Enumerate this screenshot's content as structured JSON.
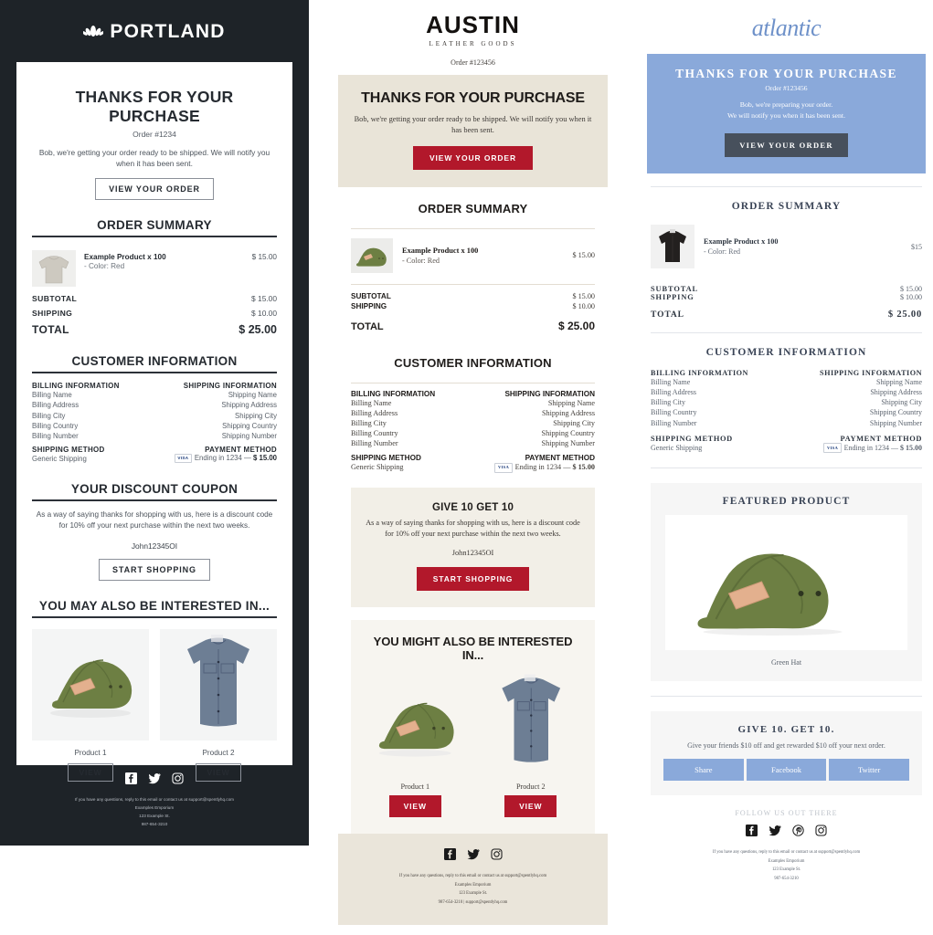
{
  "portland": {
    "brand": "PORTLAND",
    "logo_icon": "lotus-icon",
    "heading": "THANKS FOR YOUR PURCHASE",
    "order_number": "Order #1234",
    "intro": "Bob, we're getting your order ready to be shipped. We will notify you when it has been sent.",
    "cta": "VIEW YOUR ORDER",
    "order_summary_title": "ORDER SUMMARY",
    "item": {
      "name": "Example Product x 100",
      "option": "- Color: Red",
      "price": "$ 15.00",
      "image": "grey-sweater"
    },
    "totals": [
      {
        "label": "SUBTOTAL",
        "value": "$ 15.00"
      },
      {
        "label": "SHIPPING",
        "value": "$ 10.00"
      },
      {
        "label": "TOTAL",
        "value": "$ 25.00"
      }
    ],
    "customer_info_title": "CUSTOMER INFORMATION",
    "billing_title": "BILLING INFORMATION",
    "billing_lines": [
      "Billing Name",
      "Billing Address",
      "Billing City",
      "Billing Country",
      "Billing Number"
    ],
    "shipping_title": "SHIPPING INFORMATION",
    "shipping_lines": [
      "Shipping Name",
      "Shipping Address",
      "Shipping City",
      "Shipping Country",
      "Shipping Number"
    ],
    "shipping_method_title": "SHIPPING METHOD",
    "shipping_method_value": "Generic Shipping",
    "payment_method_title": "PAYMENT METHOD",
    "payment_card": "VISA",
    "payment_text": "Ending in 1234 — ",
    "payment_amount": "$ 15.00",
    "coupon_title": "YOUR DISCOUNT COUPON",
    "coupon_text": "As a way of saying thanks for shopping with us, here is a discount code for 10% off your next purchase within the next two weeks.",
    "coupon_code": "John12345OI",
    "coupon_cta": "START SHOPPING",
    "recs_title": "YOU MAY ALSO BE INTERESTED IN...",
    "recs": [
      {
        "name": "Product 1",
        "cta": "VIEW",
        "image": "green-hat"
      },
      {
        "name": "Product 2",
        "cta": "VIEW",
        "image": "blue-shirt"
      }
    ],
    "footer": {
      "socials": [
        "facebook-icon",
        "twitter-icon",
        "instagram-icon"
      ],
      "lines": [
        "If you have any questions, reply to this email or contact us at support@spentlyhq.com",
        "Examples Emporium",
        "123 Example St.",
        "987-654-3210"
      ]
    }
  },
  "austin": {
    "brand": "AUSTIN",
    "brand_sub": "LEATHER GOODS",
    "order_number": "Order #123456",
    "heading": "THANKS FOR YOUR PURCHASE",
    "intro": "Bob, we're getting your order ready to be shipped. We will notify you when it has been sent.",
    "cta": "VIEW YOUR ORDER",
    "order_summary_title": "ORDER SUMMARY",
    "item": {
      "name": "Example Product x 100",
      "option": "- Color: Red",
      "price": "$ 15.00",
      "image": "green-hat"
    },
    "totals": [
      {
        "label": "SUBTOTAL",
        "value": "$ 15.00"
      },
      {
        "label": "SHIPPING",
        "value": "$ 10.00"
      },
      {
        "label": "TOTAL",
        "value": "$ 25.00"
      }
    ],
    "customer_info_title": "CUSTOMER INFORMATION",
    "billing_title": "BILLING INFORMATION",
    "billing_lines": [
      "Billing Name",
      "Billing Address",
      "Billing City",
      "Billing Country",
      "Billing Number"
    ],
    "shipping_title": "SHIPPING INFORMATION",
    "shipping_lines": [
      "Shipping Name",
      "Shipping Address",
      "Shipping City",
      "Shipping Country",
      "Shipping Number"
    ],
    "shipping_method_title": "SHIPPING METHOD",
    "shipping_method_value": "Generic Shipping",
    "payment_method_title": "PAYMENT METHOD",
    "payment_card": "VISA",
    "payment_text": "Ending in 1234 — ",
    "payment_amount": "$ 15.00",
    "give_title": "GIVE 10 GET 10",
    "give_text": "As a way of saying thanks for shopping with us, here is a discount code for 10% off your next purchase within the next two weeks.",
    "give_code": "John12345OI",
    "give_cta": "START SHOPPING",
    "recs_title": "YOU MIGHT ALSO BE INTERESTED IN...",
    "recs": [
      {
        "name": "Product 1",
        "cta": "VIEW",
        "image": "green-hat"
      },
      {
        "name": "Product 2",
        "cta": "VIEW",
        "image": "blue-shirt"
      }
    ],
    "footer": {
      "socials": [
        "facebook-icon",
        "twitter-icon",
        "instagram-icon"
      ],
      "lines": [
        "If you have any questions, reply to this email or contact us at support@spentlyhq.com",
        "Examples Emporium",
        "123 Example St.",
        "987-654-3210 | support@spentlyhq.com"
      ]
    }
  },
  "atlantic": {
    "brand": "atlantic",
    "heading": "THANKS FOR YOUR PURCHASE",
    "order_number": "Order #123456",
    "intro_line1": "Bob, we're preparing your order.",
    "intro_line2": "We will notify you when it has been sent.",
    "cta": "VIEW YOUR ORDER",
    "order_summary_title": "ORDER SUMMARY",
    "item": {
      "name": "Example Product x 100",
      "option": "- Color: Red",
      "price": "$15",
      "image": "black-sweater"
    },
    "totals": [
      {
        "label": "SUBTOTAL",
        "value": "$ 15.00"
      },
      {
        "label": "SHIPPING",
        "value": "$ 10.00"
      },
      {
        "label": "TOTAL",
        "value": "$ 25.00"
      }
    ],
    "customer_info_title": "CUSTOMER INFORMATION",
    "billing_title": "BILLING INFORMATION",
    "billing_lines": [
      "Billing Name",
      "Billing Address",
      "Billing City",
      "Billing Country",
      "Billing Number"
    ],
    "shipping_title": "SHIPPING INFORMATION",
    "shipping_lines": [
      "Shipping Name",
      "Shipping Address",
      "Shipping City",
      "Shipping Country",
      "Shipping Number"
    ],
    "shipping_method_title": "SHIPPING METHOD",
    "shipping_method_value": "Generic Shipping",
    "payment_method_title": "PAYMENT METHOD",
    "payment_card": "VISA",
    "payment_text": "Ending in 1234 — ",
    "payment_amount": "$ 15.00",
    "featured_title": "FEATURED PRODUCT",
    "featured_name": "Green Hat",
    "featured_image": "green-hat",
    "give_title": "GIVE 10. GET 10.",
    "give_text": "Give your friends $10 off and get rewarded $10 off your next order.",
    "share_buttons": [
      "Share",
      "Facebook",
      "Twitter"
    ],
    "follow_title": "FOLLOW US OUT THERE",
    "footer": {
      "socials": [
        "facebook-icon",
        "twitter-icon",
        "pinterest-icon",
        "instagram-icon"
      ],
      "lines": [
        "If you have any questions, reply to this email or contact us at support@spentlyhq.com",
        "Examples Emporium",
        "123 Example St.",
        "987-654-3210"
      ]
    }
  },
  "colors": {
    "portland_bg": "#1e2328",
    "austin_accent": "#b2182b",
    "austin_hero_bg": "#e9e4d8",
    "austin_footer_bg": "#eae5da",
    "atlantic_accent": "#8aa9da",
    "atlantic_button": "#47505c"
  }
}
